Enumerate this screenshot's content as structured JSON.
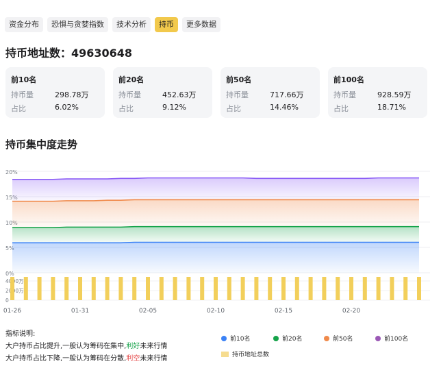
{
  "tabs": [
    {
      "label": "资金分布",
      "active": false
    },
    {
      "label": "恐惧与贪婪指数",
      "active": false
    },
    {
      "label": "技术分析",
      "active": false
    },
    {
      "label": "持币",
      "active": true
    },
    {
      "label": "更多数据",
      "active": false
    }
  ],
  "address_title": "持币地址数：49630648",
  "cards": [
    {
      "title": "前10名",
      "hold_label": "持币量",
      "hold_value": "298.78万",
      "pct_label": "占比",
      "pct_value": "6.02%"
    },
    {
      "title": "前20名",
      "hold_label": "持币量",
      "hold_value": "452.63万",
      "pct_label": "占比",
      "pct_value": "9.12%"
    },
    {
      "title": "前50名",
      "hold_label": "持币量",
      "hold_value": "717.66万",
      "pct_label": "占比",
      "pct_value": "14.46%"
    },
    {
      "title": "前100名",
      "hold_label": "持币量",
      "hold_value": "928.59万",
      "pct_label": "占比",
      "pct_value": "18.71%"
    }
  ],
  "section_title": "持币集中度走势",
  "chart_data": {
    "type": "area",
    "y_ticks": [
      "20%",
      "15%",
      "10%",
      "5%",
      "0%"
    ],
    "ylim": [
      0,
      20
    ],
    "x_ticks": [
      "01-26",
      "01-31",
      "02-05",
      "02-10",
      "02-15",
      "02-20"
    ],
    "bar_y_ticks": [
      "4000万",
      "2000万",
      "0"
    ],
    "bar_ylim": [
      0,
      4000
    ],
    "series": [
      {
        "name": "前10名",
        "color": "#3b82f6",
        "values": [
          5.9,
          5.9,
          5.9,
          5.9,
          5.9,
          5.9,
          5.9,
          5.9,
          5.9,
          6.0,
          6.0,
          6.0,
          6.0,
          6.0,
          6.0,
          6.0,
          6.0,
          6.0,
          6.0,
          6.0,
          6.0,
          6.0,
          6.0,
          6.0,
          6.0,
          6.0,
          6.0,
          6.0,
          6.0,
          6.0,
          6.0
        ]
      },
      {
        "name": "前20名",
        "color": "#16a34a",
        "values": [
          8.9,
          8.9,
          8.9,
          8.9,
          9.0,
          9.0,
          9.0,
          9.0,
          9.0,
          9.1,
          9.1,
          9.1,
          9.1,
          9.1,
          9.1,
          9.1,
          9.1,
          9.1,
          9.1,
          9.1,
          9.1,
          9.1,
          9.1,
          9.1,
          9.1,
          9.1,
          9.1,
          9.1,
          9.1,
          9.1,
          9.1
        ]
      },
      {
        "name": "前50名",
        "color": "#f08a4b",
        "values": [
          14.1,
          14.1,
          14.1,
          14.1,
          14.2,
          14.2,
          14.2,
          14.3,
          14.3,
          14.4,
          14.4,
          14.4,
          14.4,
          14.4,
          14.4,
          14.4,
          14.4,
          14.4,
          14.4,
          14.4,
          14.4,
          14.4,
          14.4,
          14.4,
          14.4,
          14.4,
          14.4,
          14.4,
          14.4,
          14.4,
          14.4
        ]
      },
      {
        "name": "前100名",
        "color": "#8b5cf6",
        "values": [
          18.4,
          18.4,
          18.4,
          18.4,
          18.5,
          18.5,
          18.5,
          18.5,
          18.6,
          18.6,
          18.7,
          18.7,
          18.7,
          18.7,
          18.7,
          18.7,
          18.7,
          18.7,
          18.6,
          18.6,
          18.6,
          18.6,
          18.6,
          18.6,
          18.6,
          18.6,
          18.6,
          18.7,
          18.7,
          18.7,
          18.7
        ]
      }
    ],
    "bars": {
      "name": "持币地址总数",
      "color": "#f2cf5b",
      "values": [
        4900,
        4900,
        4900,
        4900,
        4900,
        4900,
        4900,
        4900,
        4900,
        4900,
        4900,
        4900,
        4900,
        4900,
        4900,
        4900,
        4900,
        4900,
        4900,
        4900,
        4900,
        4900,
        4900,
        4900,
        4900,
        4900,
        4900,
        4900,
        4900,
        4900,
        4950
      ]
    }
  },
  "notes": {
    "title": "指标说明:",
    "line1_a": "大户持币占比提升,一般认为筹码在集中,",
    "line1_em": "利好",
    "line1_b": "未来行情",
    "line2_a": "大户持币占比下降,一般认为筹码在分散,",
    "line2_em": "利空",
    "line2_b": "未来行情"
  },
  "legend": [
    {
      "label": "前10名",
      "color": "#3b82f6"
    },
    {
      "label": "前20名",
      "color": "#16a34a"
    },
    {
      "label": "前50名",
      "color": "#f08a4b"
    },
    {
      "label": "前100名",
      "color": "#9b59b6"
    },
    {
      "label": "持币地址总数",
      "color": "#f6dc8f"
    }
  ]
}
